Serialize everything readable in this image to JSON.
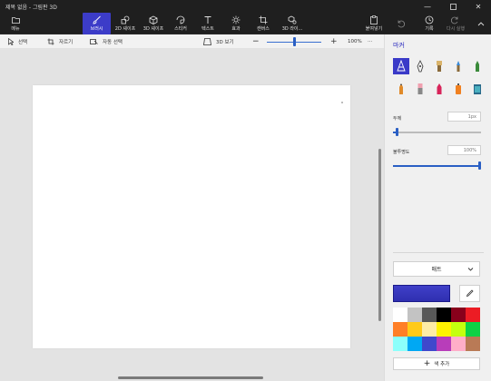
{
  "window": {
    "title": "제목 없음 - 그림판 3D"
  },
  "ribbon": {
    "menu": "메뉴",
    "tabs": [
      {
        "id": "brushes",
        "label": "브러시",
        "icon": "brush-icon",
        "active": true
      },
      {
        "id": "2d",
        "label": "2D 셰이프",
        "icon": "2d-shapes-icon"
      },
      {
        "id": "3d",
        "label": "3D 셰이프",
        "icon": "3d-shapes-icon"
      },
      {
        "id": "stickers",
        "label": "스티커",
        "icon": "sticker-icon"
      },
      {
        "id": "text",
        "label": "텍스트",
        "icon": "text-icon"
      },
      {
        "id": "effects",
        "label": "효과",
        "icon": "effects-icon"
      },
      {
        "id": "canvas",
        "label": "캔버스",
        "icon": "canvas-icon"
      },
      {
        "id": "3dlib",
        "label": "3D 라이...",
        "icon": "3d-library-icon"
      }
    ],
    "paste": "붙여넣기",
    "history": "기록",
    "redo": "다시 실행"
  },
  "toolbar": {
    "select": "선택",
    "crop": "자르기",
    "magic_select": "자동 선택",
    "view_3d": "3D 보기",
    "zoom_percent": "100%",
    "more": "···"
  },
  "panel": {
    "title": "마커",
    "brushes": [
      {
        "name": "marker",
        "icon": "marker-icon",
        "selected": true
      },
      {
        "name": "calligraphy-pen",
        "icon": "calligraphy-pen-icon"
      },
      {
        "name": "oil-brush",
        "icon": "oil-brush-icon"
      },
      {
        "name": "watercolor",
        "icon": "watercolor-icon"
      },
      {
        "name": "pixel-pen",
        "icon": "pixel-pen-icon"
      },
      {
        "name": "pencil",
        "icon": "pencil-icon"
      },
      {
        "name": "eraser",
        "icon": "eraser-icon"
      },
      {
        "name": "crayon",
        "icon": "crayon-icon"
      },
      {
        "name": "spray-can",
        "icon": "spray-can-icon"
      },
      {
        "name": "fill",
        "icon": "fill-bucket-icon"
      }
    ],
    "thickness_label": "두께",
    "thickness_value": "1px",
    "thickness_level": 0.05,
    "opacity_label": "불투명도",
    "opacity_value": "100%",
    "opacity_level": 1.0,
    "finish_value": "매트",
    "current_color": "#4040c8",
    "add_color": "색 추가",
    "swatches": [
      "#ffffff",
      "#c3c3c3",
      "#585858",
      "#000000",
      "#88001b",
      "#ec1c24",
      "#ff7f27",
      "#ffca18",
      "#fdeca6",
      "#fff200",
      "#c4ff0e",
      "#0ed145",
      "#8cfffb",
      "#00a8f3",
      "#3f48cc",
      "#b83dba",
      "#ffaec8",
      "#b97a56"
    ]
  },
  "colors": {
    "accent": "#3c3cc8",
    "ribbon_bg": "#1f1f1f",
    "workspace_bg": "#e3e3e3",
    "panel_bg": "#f0f0f0"
  }
}
